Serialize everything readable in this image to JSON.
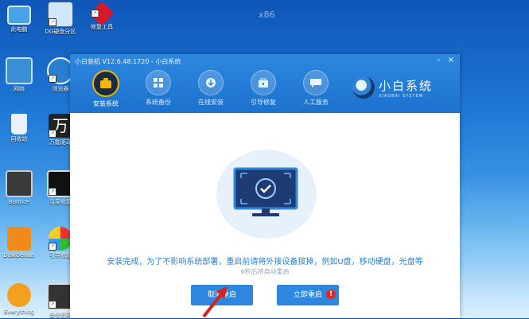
{
  "desktop": {
    "watermark": "x86",
    "icons": [
      {
        "label": "此电脑",
        "icon": "computer-icon"
      },
      {
        "label": "DG硬盘分区",
        "icon": "partition-tool-icon"
      },
      {
        "label": "修复工具",
        "icon": "repair-tool-icon"
      },
      {
        "label": "网络",
        "icon": "network-icon"
      },
      {
        "label": "浏览器",
        "icon": "browser-icon"
      },
      {
        "label": "回收站",
        "icon": "recycle-bin-icon"
      },
      {
        "label": "万能驱动",
        "icon": "driver-icon"
      },
      {
        "label": "Bootice",
        "icon": "bootice-icon"
      },
      {
        "label": "引导修复",
        "icon": "boot-repair-icon"
      },
      {
        "label": "DiskGenius",
        "icon": "diskgenius-icon"
      },
      {
        "label": "引导修复",
        "icon": "pinwheel-icon"
      },
      {
        "label": "Everything",
        "icon": "everything-icon"
      },
      {
        "label": "备份还原",
        "icon": "backup-icon"
      }
    ]
  },
  "window": {
    "title": "小白装机 V12.6.48.1720 - 小白系统",
    "nav": [
      {
        "label": "安装系统",
        "icon": "install-system-icon",
        "active": true
      },
      {
        "label": "系统备份",
        "icon": "backup-system-icon",
        "active": false
      },
      {
        "label": "在线安装",
        "icon": "online-install-icon",
        "active": false
      },
      {
        "label": "引导修复",
        "icon": "boot-repair-icon",
        "active": false
      },
      {
        "label": "人工服务",
        "icon": "chat-service-icon",
        "active": false
      }
    ],
    "logo": {
      "name": "小白系统",
      "sub": "XIAOBAI SYSTEM"
    }
  },
  "content": {
    "message": "安装完成，为了不影响系统部署，重启前请将外接设备拔掉，例如U盘，移动硬盘，光盘等",
    "countdown": "6秒后将自动重启",
    "btn_cancel": "取消重启",
    "btn_restart": "立即重启",
    "badge": "!"
  },
  "colors": {
    "accent": "#2e86de",
    "message": "#2b7fd8",
    "badge": "#e8281e",
    "active_ring": "#f4b400"
  }
}
